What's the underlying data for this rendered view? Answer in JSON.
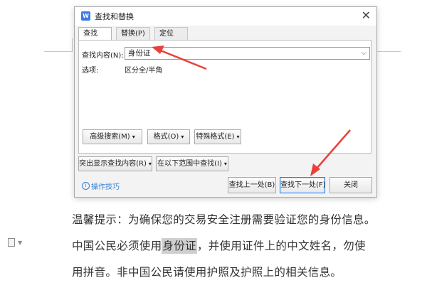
{
  "dialog": {
    "title": "查找和替换",
    "tabs": [
      {
        "label": "查找(D)"
      },
      {
        "label": "替换(P)"
      },
      {
        "label": "定位(G)"
      }
    ],
    "find_label": "查找内容(N):",
    "find_value": "身份证",
    "options_label": "选项:",
    "options_value": "区分全/半角",
    "advanced_label": "高级搜索(M)",
    "format_label": "格式(O)",
    "special_label": "特殊格式(E)",
    "highlight_label": "突出显示查找内容(R)",
    "scope_label": "在以下范围中查找(I)",
    "tips_label": "操作技巧",
    "find_prev_label": "查找上一处(B)",
    "find_next_label": "查找下一处(F)",
    "close_label": "关闭"
  },
  "document": {
    "line1": "温馨提示：为确保您的交易安全注册需要验证您的身份信息。",
    "line2_before": "中国公民必须使用",
    "line2_highlight": "身份证",
    "line2_after": "，并使用证件上的中文姓名，勿使",
    "line3": "用拼音。非中国公民请使用护照及护照上的相关信息。"
  },
  "colors": {
    "accent": "#2e7de0",
    "annotation_arrow": "#e8413a",
    "highlight": "#cfcfcf"
  }
}
